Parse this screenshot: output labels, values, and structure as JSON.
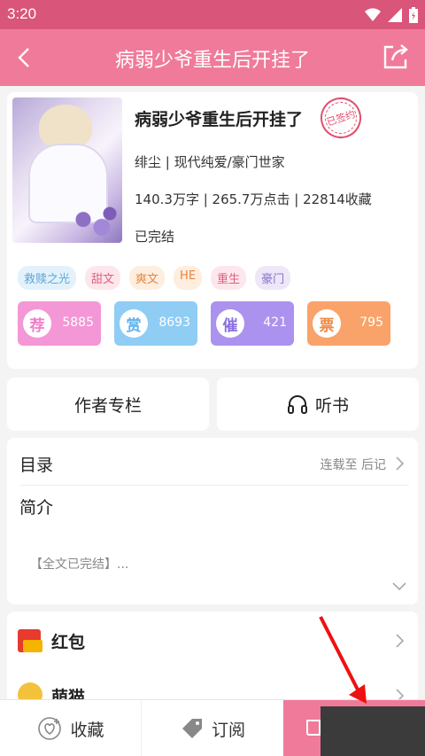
{
  "status_bar": {
    "time": "3:20",
    "icons": [
      "wifi-icon",
      "signal-icon",
      "battery-icon"
    ]
  },
  "app_bar": {
    "title": "病弱少爷重生后开挂了",
    "back_icon": "chevron-left-icon",
    "share_icon": "share-icon"
  },
  "book": {
    "title": "病弱少爷重生后开挂了",
    "signed_stamp": "已签约",
    "meta_line1": "绯尘 | 现代纯爱/豪门世家",
    "meta_line2": "140.3万字 | 265.7万点击 | 22814收藏",
    "meta_line3": "已完结",
    "tags": [
      {
        "label": "救赎之光",
        "color": "#5aa7d6",
        "bg": "#e3f1fb"
      },
      {
        "label": "甜文",
        "color": "#e0607e",
        "bg": "#fde7ec"
      },
      {
        "label": "爽文",
        "color": "#e8843a",
        "bg": "#fdeee0"
      },
      {
        "label": "HE",
        "color": "#e8843a",
        "bg": "#fdeee0"
      },
      {
        "label": "重生",
        "color": "#e0607e",
        "bg": "#fde7ec"
      },
      {
        "label": "豪门",
        "color": "#8b72c8",
        "bg": "#ede7f8"
      }
    ],
    "stats": [
      {
        "badge": "荐",
        "value": "5885",
        "color": "#f497d6",
        "badge_color": "#ee7fc8"
      },
      {
        "badge": "赏",
        "value": "8693",
        "color": "#8fcdf5",
        "badge_color": "#5fb2ea"
      },
      {
        "badge": "催",
        "value": "421",
        "color": "#ab92ee",
        "badge_color": "#8b6ee0"
      },
      {
        "badge": "票",
        "value": "795",
        "color": "#f9a36a",
        "badge_color": "#f08a45"
      }
    ]
  },
  "actions": {
    "author_column": "作者专栏",
    "listen": "听书"
  },
  "toc": {
    "label": "目录",
    "status": "连载至 后记",
    "intro_label": "简介",
    "intro_text": "【全文已完结】..."
  },
  "gifts": {
    "red_packet": "红包",
    "second": "萌猫"
  },
  "bottom_bar": {
    "favorite": "收藏",
    "subscribe": "订阅"
  },
  "colors": {
    "accent": "#f07a99",
    "status": "#d9557a"
  }
}
